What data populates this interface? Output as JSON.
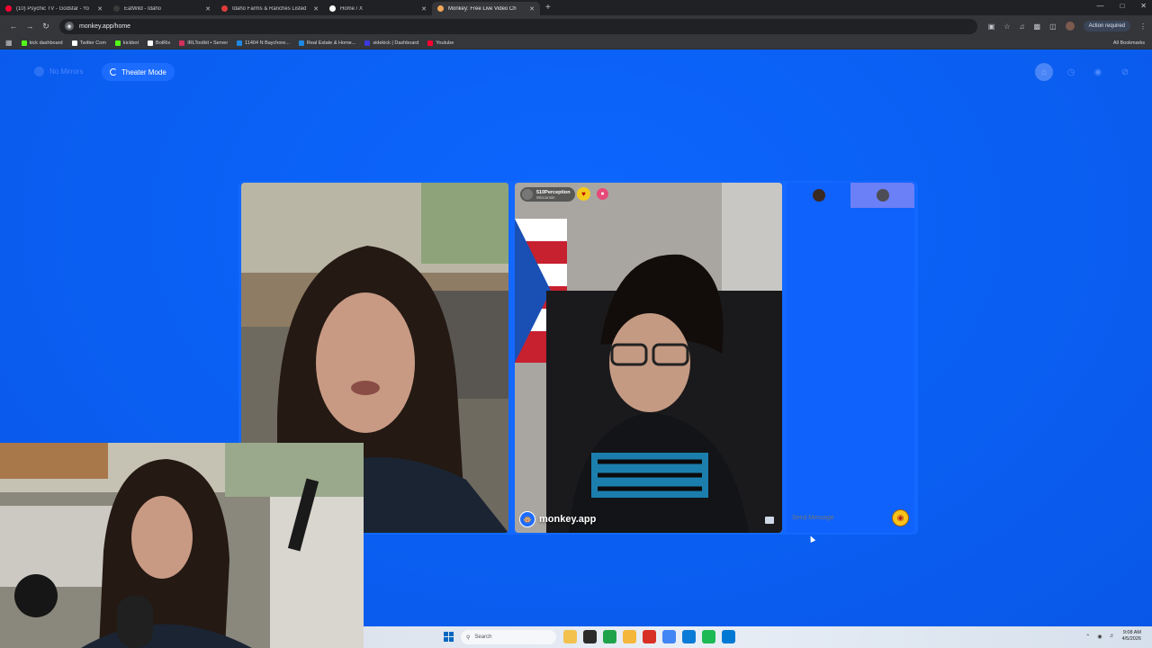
{
  "browser": {
    "tabs": [
      {
        "title": "(10) Psychic TV - Godstar - Yo",
        "color": "#ff0033",
        "active": false
      },
      {
        "title": "EatWild - Idaho",
        "color": "#3a3a3a",
        "active": false
      },
      {
        "title": "Idaho Farms & Ranches Listed",
        "color": "#e03b3b",
        "active": false
      },
      {
        "title": "Home / X",
        "color": "#ffffff",
        "active": false
      },
      {
        "title": "Monkey: Free Live Video Ch",
        "color": "#f2a65a",
        "active": true
      }
    ],
    "new_tab": "+",
    "url": "monkey.app/home",
    "action_required": "Action required",
    "bookmarks": [
      {
        "label": "kick dashboard",
        "color": "#53fc18"
      },
      {
        "label": "Twitter Com",
        "color": "#ffffff"
      },
      {
        "label": "kickbot",
        "color": "#53fc18"
      },
      {
        "label": "BotRix",
        "color": "#ffffff"
      },
      {
        "label": "IRLToolkit • Server",
        "color": "#d0315c"
      },
      {
        "label": "11404 N Baychore...",
        "color": "#1e88e5"
      },
      {
        "label": "Real Estate & Home...",
        "color": "#1e88e5"
      },
      {
        "label": "sidekick | Dashboard",
        "color": "#3a3adf"
      },
      {
        "label": "Youtube",
        "color": "#ff0033"
      }
    ],
    "all_bookmarks": "All Bookmarks"
  },
  "page": {
    "no_mirror": "No Mirrors",
    "theater_mode": "Theater Mode",
    "top_icons": [
      "home-icon",
      "history-icon",
      "eye-icon",
      "slash-icon"
    ]
  },
  "call": {
    "remote_user": {
      "name": "510Perception",
      "location": "Wisconsin"
    },
    "watermark": "monkey.app",
    "chat_placeholder": "Send Message"
  },
  "taskbar": {
    "search": "Search",
    "time": "9:08 AM",
    "date": "4/5/2026",
    "apps": [
      {
        "name": "file-explorer-icon",
        "color": "#f2c14e"
      },
      {
        "name": "task-view-icon",
        "color": "#2b2b2b"
      },
      {
        "name": "browser-icon",
        "color": "#1fa34a"
      },
      {
        "name": "folder-icon",
        "color": "#f5b73b"
      },
      {
        "name": "app-icon",
        "color": "#d93025"
      },
      {
        "name": "chrome-icon",
        "color": "#4285f4"
      },
      {
        "name": "edge-icon",
        "color": "#0a7bd6"
      },
      {
        "name": "spotify-icon",
        "color": "#1db954"
      },
      {
        "name": "store-icon",
        "color": "#0078d4"
      }
    ]
  }
}
